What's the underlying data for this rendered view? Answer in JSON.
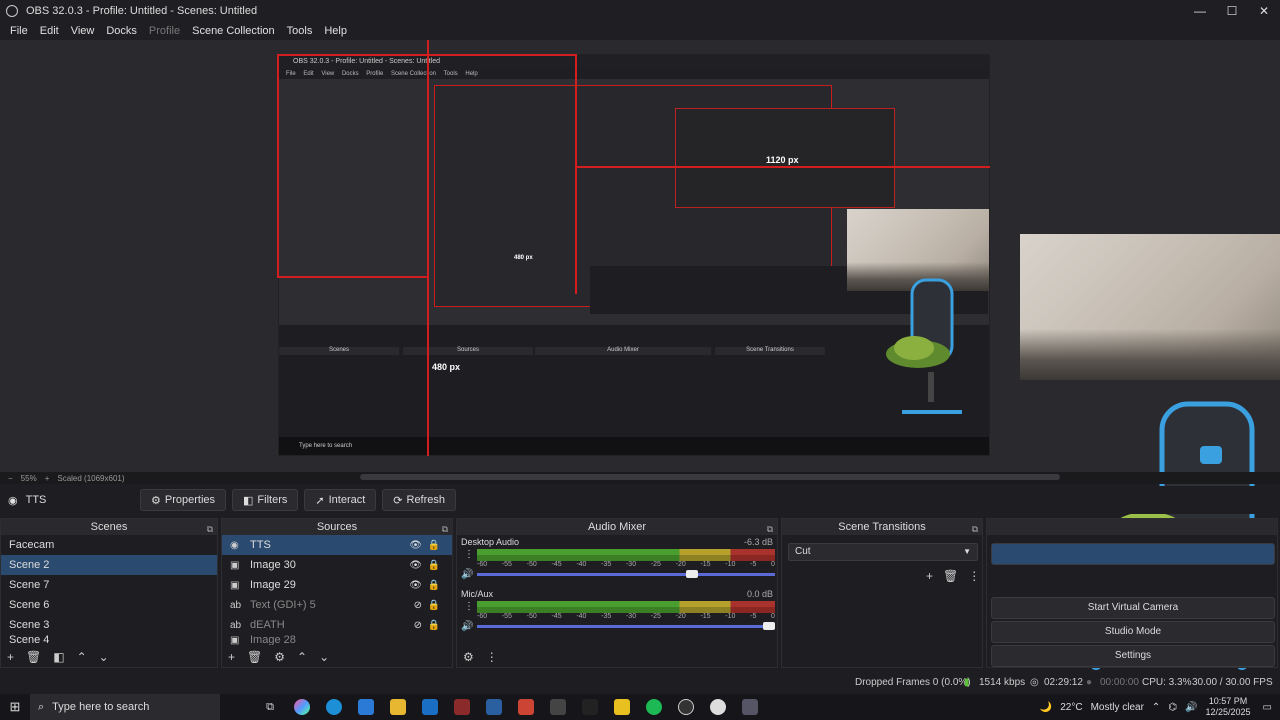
{
  "window": {
    "title": "OBS 32.0.3 - Profile: Untitled - Scenes: Untitled",
    "minimize": "—",
    "maximize": "☐",
    "close": "✕"
  },
  "menu": {
    "file": "File",
    "edit": "Edit",
    "view": "View",
    "docks": "Docks",
    "profile": "Profile",
    "scene_collection": "Scene Collection",
    "tools": "Tools",
    "help": "Help"
  },
  "preview": {
    "inner_title": "OBS 32.0.3 - Profile: Untitled - Scenes: Untitled",
    "inner_menu": [
      "File",
      "Edit",
      "View",
      "Docks",
      "Profile",
      "Scene Collection",
      "Tools",
      "Help"
    ],
    "width_label": "1120 px",
    "height_label": "480 px",
    "inner_height_label": "480 px",
    "inner_dock_titles": [
      "Scenes",
      "Sources",
      "Audio Mixer",
      "Scene Transitions"
    ],
    "inner_taskbar": "Type here to search"
  },
  "zoom": {
    "minus": "−",
    "level": "55%",
    "plus": "+",
    "mode": "Scaled (1069x601)"
  },
  "source_toolbar": {
    "source_name": "TTS",
    "properties": "Properties",
    "filters": "Filters",
    "interact": "Interact",
    "refresh": "Refresh"
  },
  "scenes": {
    "title": "Scenes",
    "items": [
      "Facecam",
      "Scene 2",
      "Scene 7",
      "Scene 6",
      "Scene 3",
      "Scene 4"
    ],
    "selected_index": 1
  },
  "sources": {
    "title": "Sources",
    "items": [
      {
        "label": "TTS",
        "icon": "browser-icon",
        "visible": true
      },
      {
        "label": "Image 30",
        "icon": "image-icon",
        "visible": true
      },
      {
        "label": "Image 29",
        "icon": "image-icon",
        "visible": true
      },
      {
        "label": "Text (GDI+) 5",
        "icon": "text-icon",
        "visible": false
      },
      {
        "label": "dEATH",
        "icon": "text-icon",
        "visible": false
      },
      {
        "label": "Image 28",
        "icon": "image-icon",
        "visible": false
      }
    ]
  },
  "audio_mixer": {
    "title": "Audio Mixer",
    "channels": [
      {
        "name": "Desktop Audio",
        "db": "-6.3 dB",
        "volume": 0.74
      },
      {
        "name": "Mic/Aux",
        "db": "0.0 dB",
        "volume": 1.0
      }
    ],
    "ticks": [
      "-60",
      "-55",
      "-50",
      "-45",
      "-40",
      "-35",
      "-30",
      "-25",
      "-20",
      "-15",
      "-10",
      "-5",
      "0"
    ]
  },
  "scene_transitions": {
    "title": "Scene Transitions",
    "selected": "Cut"
  },
  "controls": {
    "start_virtual_camera": "Start Virtual Camera",
    "studio_mode": "Studio Mode",
    "settings": "Settings"
  },
  "status": {
    "dropped_frames": "Dropped Frames 0 (0.0%)",
    "bitrate": "1514 kbps",
    "stream_time": "02:29:12",
    "rec_time": "00:00:00",
    "cpu": "CPU: 3.3%",
    "fps": "30.00 / 30.00 FPS"
  },
  "taskbar": {
    "search_placeholder": "Type here to search",
    "weather_temp": "22°C",
    "weather_text": "Mostly clear",
    "time": "10:57 PM",
    "date": "12/25/2025"
  },
  "colors": {
    "accent": "#2b4a6f",
    "guide_red": "#d21e1e"
  }
}
